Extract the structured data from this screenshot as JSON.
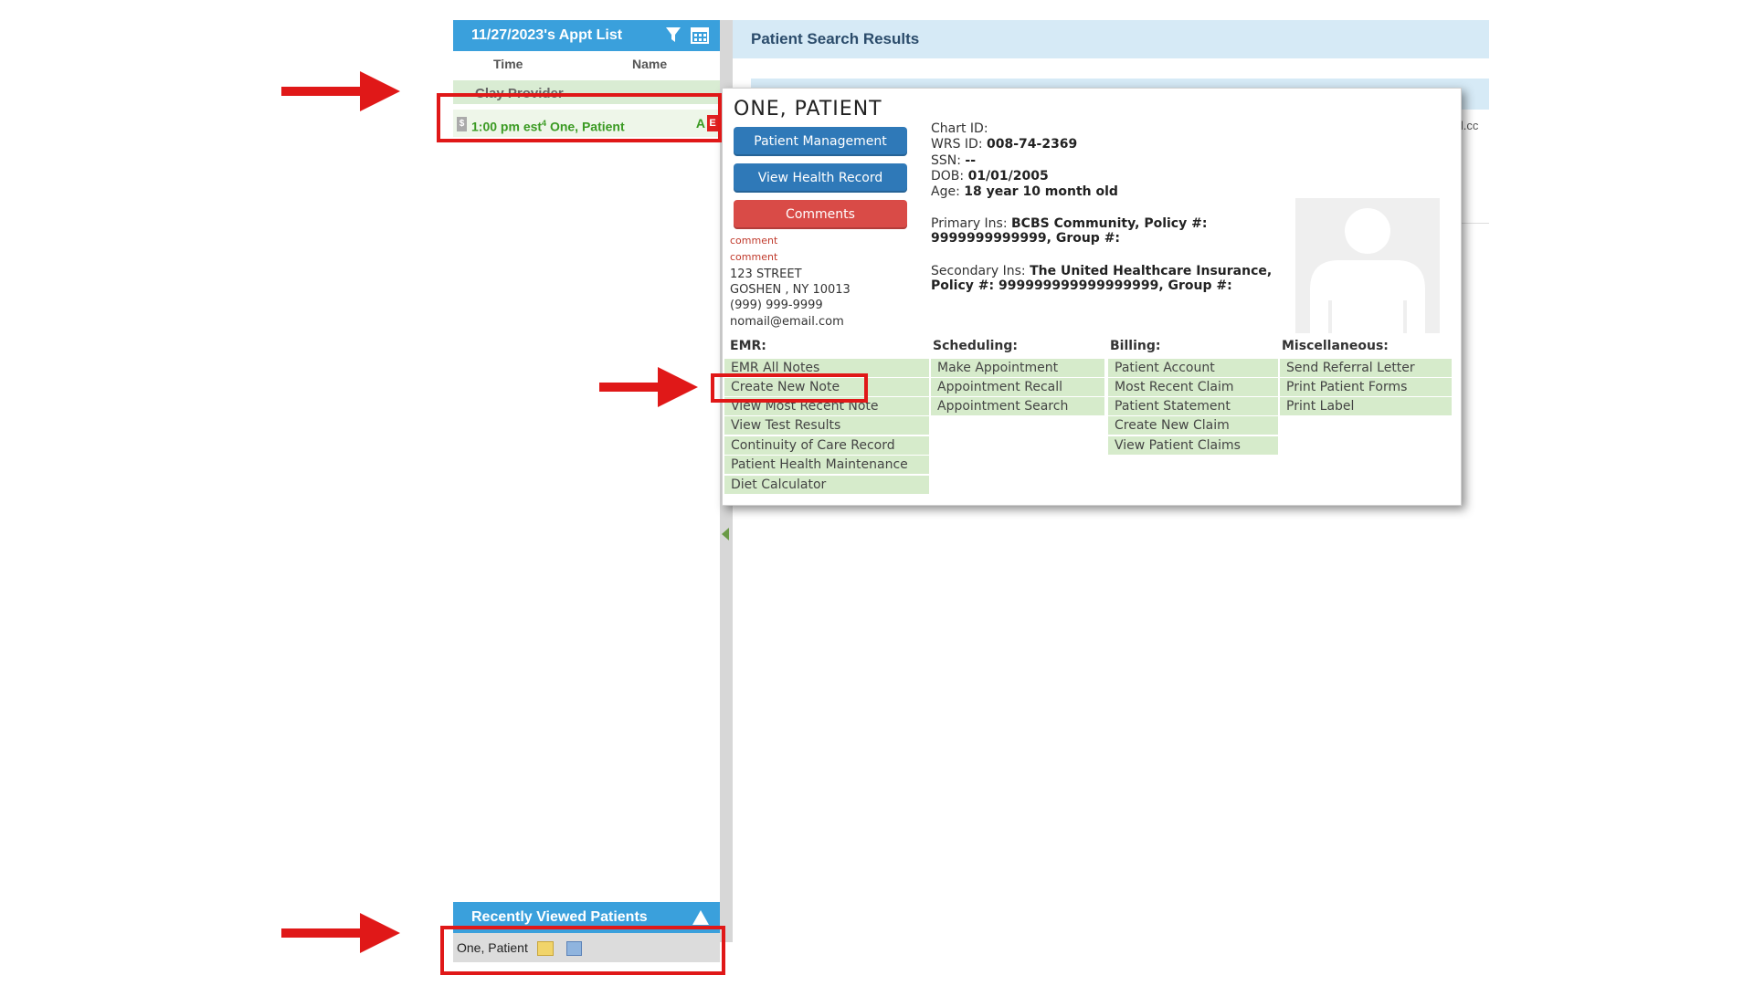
{
  "appt_list": {
    "title": "11/27/2023's Appt List",
    "col_time": "Time",
    "col_name": "Name",
    "provider_row": "Clay Provider",
    "appointment": {
      "time": "1:00 pm",
      "type": "est",
      "superscript": "4",
      "patient": "One, Patient",
      "flag_a": "A",
      "flag_e": "E",
      "dollar": "$"
    },
    "filter_icon": "filter-icon",
    "calendar_icon": "calendar-icon"
  },
  "recent": {
    "title": "Recently Viewed Patients",
    "patient": "One, Patient"
  },
  "results": {
    "title": "Patient Search Results",
    "email_fragment": "il.cc"
  },
  "popup": {
    "name": "ONE, PATIENT",
    "buttons": {
      "management": "Patient Management",
      "health": "View Health Record",
      "comments": "Comments"
    },
    "comments": [
      "comment",
      "comment"
    ],
    "address": [
      "123 STREET",
      "GOSHEN , NY 10013",
      "(999) 999-9999",
      "nomail@email.com"
    ],
    "info": {
      "chart_label": "Chart ID:",
      "chart_value": "",
      "wrs_label": "WRS ID:",
      "wrs_value": "008-74-2369",
      "ssn_label": "SSN:",
      "ssn_value": "--",
      "dob_label": "DOB:",
      "dob_value": "01/01/2005",
      "age_label": "Age:",
      "age_value": "18 year 10 month old",
      "primary_label": "Primary Ins:",
      "primary_line1": "BCBS Community, Policy #:",
      "primary_line2": "9999999999999, Group #:",
      "secondary_label": "Secondary Ins:",
      "secondary_line1": "The United Healthcare Insurance,",
      "secondary_line2": "Policy #: 999999999999999999, Group #:"
    },
    "sections": {
      "emr": {
        "title": "EMR:",
        "items": [
          "EMR All Notes",
          "Create New Note",
          "View Most Recent Note",
          "View Test Results",
          "Continuity of Care Record",
          "Patient Health Maintenance",
          "Diet Calculator"
        ]
      },
      "scheduling": {
        "title": "Scheduling:",
        "items": [
          "Make Appointment",
          "Appointment Recall",
          "Appointment Search"
        ]
      },
      "billing": {
        "title": "Billing:",
        "items": [
          "Patient Account",
          "Most Recent Claim",
          "Patient Statement",
          "Create New Claim",
          "View Patient Claims"
        ]
      },
      "misc": {
        "title": "Miscellaneous:",
        "items": [
          "Send Referral Letter",
          "Print Patient Forms",
          "Print Label"
        ]
      }
    }
  },
  "colors": {
    "header_blue": "#3aa0dc",
    "button_blue": "#2f79b8",
    "button_red": "#d94b47",
    "link_green": "#d6ebcb",
    "annotation_red": "#e01818"
  }
}
